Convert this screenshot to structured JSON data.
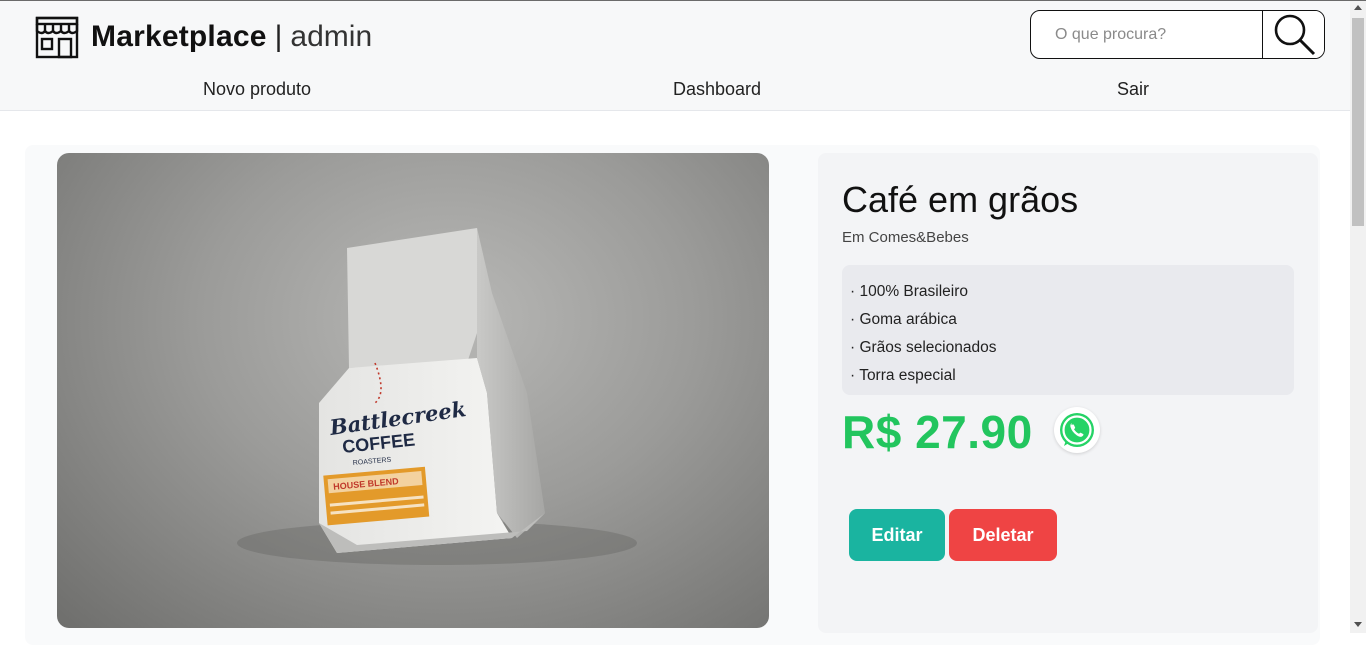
{
  "header": {
    "brand_title": "Marketplace",
    "brand_separator": "|",
    "brand_subtitle": "admin",
    "logo_icon": "store-icon",
    "search": {
      "placeholder": "O que procura?",
      "value": "",
      "icon": "search-icon"
    }
  },
  "nav": {
    "items": [
      {
        "label": "Novo produto"
      },
      {
        "label": "Dashboard"
      },
      {
        "label": "Sair"
      }
    ]
  },
  "product": {
    "name": "Café em grãos",
    "category": "Em Comes&Bebes",
    "features": [
      "· 100% Brasileiro",
      "· Goma arábica",
      "· Grãos selecionados",
      "· Torra especial"
    ],
    "price": "R$ 27.90",
    "contact_icon": "whatsapp-icon",
    "image_text": {
      "brand": "Battlecreek",
      "line2": "COFFEE",
      "line3": "ROASTERS",
      "label": "HOUSE BLEND"
    }
  },
  "actions": {
    "edit_label": "Editar",
    "delete_label": "Deletar"
  },
  "colors": {
    "price": "#22c55e",
    "edit_button": "#1ab4a0",
    "delete_button": "#ef4444"
  }
}
